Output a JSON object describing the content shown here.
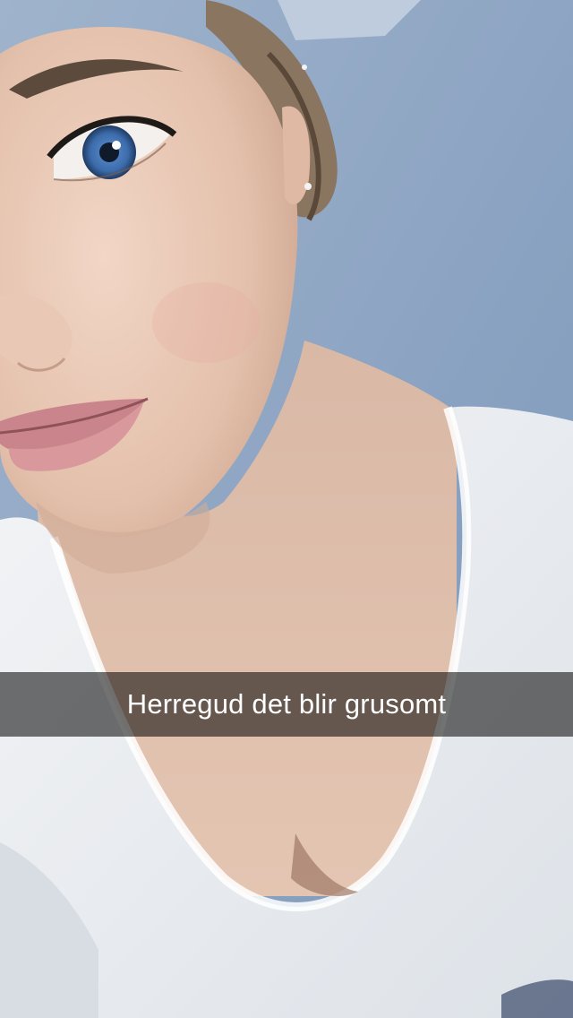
{
  "snap": {
    "caption": "Herregud det blir grusomt"
  },
  "colors": {
    "wall": "#8fa7c4",
    "skin": "#e8c7b3",
    "shirt": "#eef0f3",
    "hair": "#6b5a48",
    "iris": "#3e6fae",
    "lips": "#c9848a",
    "caption_bar": "#000000"
  }
}
